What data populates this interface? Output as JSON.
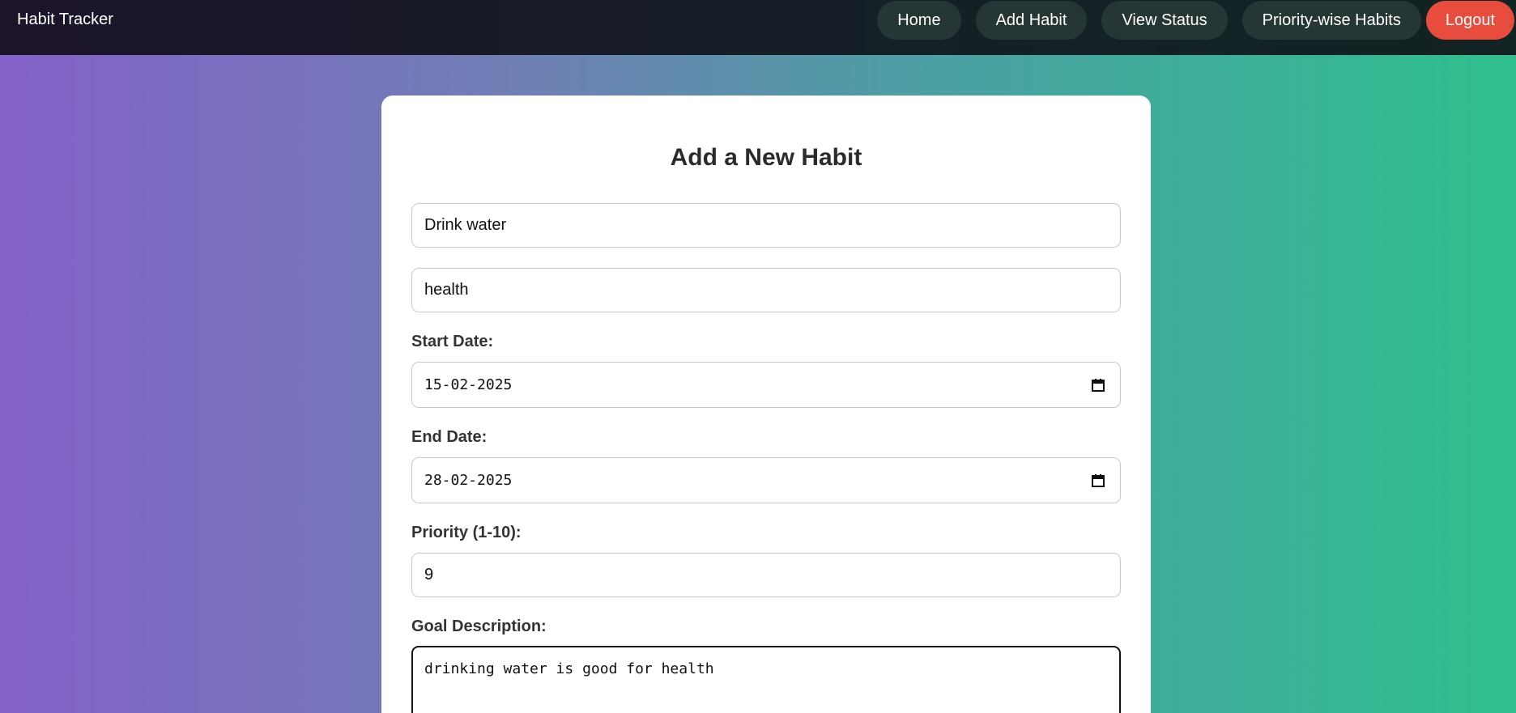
{
  "navbar": {
    "brand": "Habit Tracker",
    "links": {
      "home": "Home",
      "add_habit": "Add Habit",
      "view_status": "View Status",
      "priority_habits": "Priority-wise Habits",
      "logout": "Logout"
    }
  },
  "form": {
    "title": "Add a New Habit",
    "habit_name": "Drink water",
    "category": "health",
    "start_date_label": "Start Date:",
    "start_date": "15-02-2025",
    "end_date_label": "End Date:",
    "end_date": "28-02-2025",
    "priority_label": "Priority (1-10):",
    "priority": "9",
    "goal_label": "Goal Description:",
    "goal": "drinking water is good for health"
  },
  "colors": {
    "navbar_bg": "#151c24",
    "nav_button_bg": "#253634",
    "logout_bg": "#e74c3c",
    "gradient_start": "#8361c8",
    "gradient_end": "#2fbf8e"
  },
  "icons": {
    "date_picker": "calendar-icon"
  }
}
